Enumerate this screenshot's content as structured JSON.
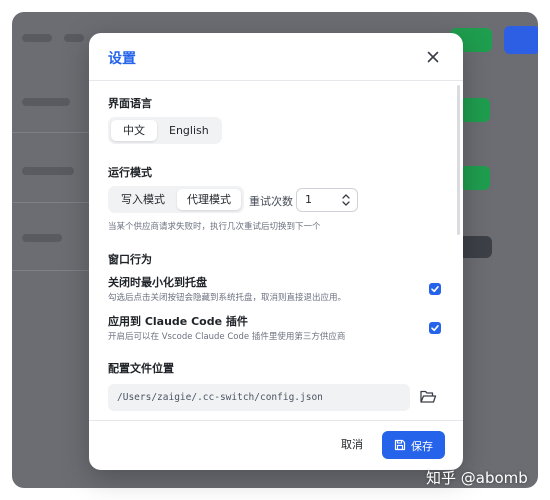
{
  "dialog": {
    "title": "设置",
    "close_icon": "close-icon"
  },
  "language": {
    "section_title": "界面语言",
    "options": [
      "中文",
      "English"
    ],
    "selected": "中文"
  },
  "run_mode": {
    "section_title": "运行模式",
    "options": [
      "写入模式",
      "代理模式"
    ],
    "selected": "代理模式",
    "retry_label": "重试次数",
    "retry_value": "1",
    "hint": "当某个供应商请求失败时，执行几次重试后切换到下一个"
  },
  "window_behavior": {
    "section_title": "窗口行为",
    "items": [
      {
        "title": "关闭时最小化到托盘",
        "description": "勾选后点击关闭按钮会隐藏到系统托盘，取消则直接退出应用。",
        "checked": true
      },
      {
        "title": "应用到 Claude Code 插件",
        "description": "开启后可以在 Vscode Claude Code 插件里使用第三方供应商",
        "checked": true
      }
    ]
  },
  "config_file": {
    "section_title": "配置文件位置",
    "path": "/Users/zaigie/.cc-switch/config.json",
    "folder_icon": "folder-icon"
  },
  "footer": {
    "cancel_label": "取消",
    "save_label": "保存",
    "save_icon": "save-icon"
  },
  "watermark": "知乎 @abomb",
  "colors": {
    "accent": "#2563eb",
    "backdrop": "#6b6d72",
    "green": "#1f9e4f"
  }
}
